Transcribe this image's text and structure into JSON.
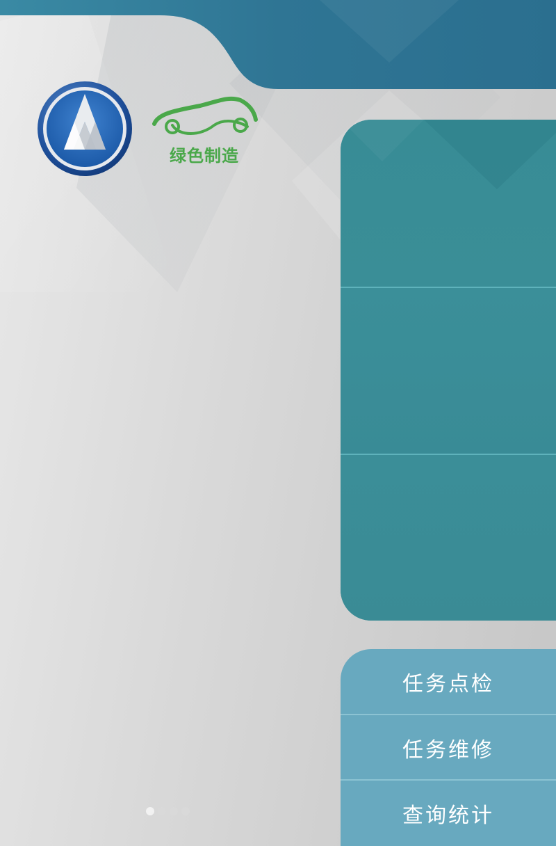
{
  "logos": {
    "brand_logo_icon": "triangle-emblem-icon",
    "green_logo_text": "绿色制造",
    "green_logo_icon": "car-silhouette-icon"
  },
  "menu": {
    "items": [
      {
        "label": "任务点检"
      },
      {
        "label": "任务维修"
      },
      {
        "label": "查询统计"
      }
    ]
  },
  "pager": {
    "count": 4,
    "active_index": 0
  },
  "colors": {
    "top_band": "#2f7a96",
    "teal_panel": "#3a8c97",
    "menu_panel": "#68a9bf",
    "menu_text": "#ffffff",
    "green_logo": "#4aa84a"
  }
}
